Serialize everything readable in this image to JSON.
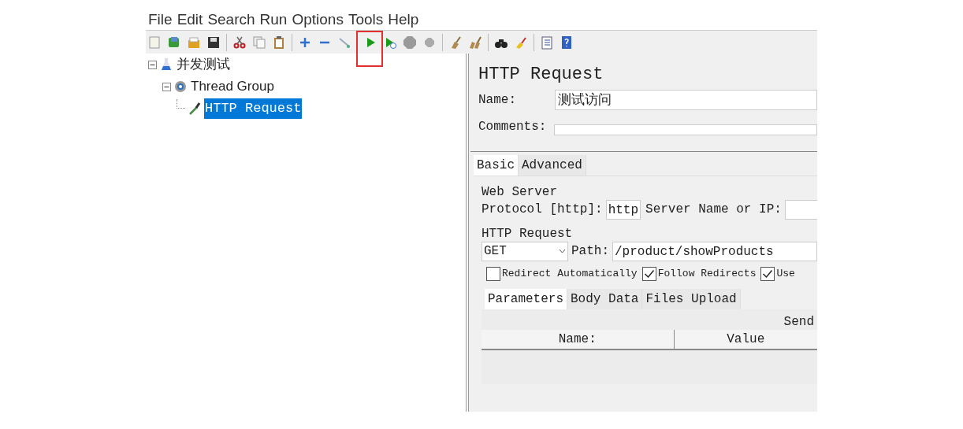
{
  "menu": [
    {
      "label": "File"
    },
    {
      "label": "Edit"
    },
    {
      "label": "Search"
    },
    {
      "label": "Run"
    },
    {
      "label": "Options"
    },
    {
      "label": "Tools"
    },
    {
      "label": "Help"
    }
  ],
  "toolbar": [
    {
      "kind": "button",
      "highlighted": false
    },
    {
      "kind": "button",
      "highlighted": false
    },
    {
      "kind": "button",
      "highlighted": false
    },
    {
      "kind": "button",
      "highlighted": false
    },
    {
      "kind": "separator"
    },
    {
      "kind": "button",
      "highlighted": false
    },
    {
      "kind": "button",
      "highlighted": false
    },
    {
      "kind": "button",
      "highlighted": false
    },
    {
      "kind": "separator"
    },
    {
      "kind": "button",
      "highlighted": false
    },
    {
      "kind": "button",
      "highlighted": false
    },
    {
      "kind": "button",
      "highlighted": false
    },
    {
      "kind": "separator"
    },
    {
      "kind": "button",
      "highlighted": true
    },
    {
      "kind": "button",
      "highlighted": false
    },
    {
      "kind": "button",
      "highlighted": false
    },
    {
      "kind": "button",
      "highlighted": false
    },
    {
      "kind": "separator"
    },
    {
      "kind": "button",
      "highlighted": false
    },
    {
      "kind": "button",
      "highlighted": false
    },
    {
      "kind": "separator"
    },
    {
      "kind": "button",
      "highlighted": false
    },
    {
      "kind": "button",
      "highlighted": false
    },
    {
      "kind": "separator"
    },
    {
      "kind": "button",
      "highlighted": false
    },
    {
      "kind": "button",
      "highlighted": false
    }
  ],
  "tree": [
    {
      "label": "并发测试",
      "expanded": true,
      "selected": false,
      "children": [
        {
          "label": "Thread Group",
          "expanded": true,
          "selected": false,
          "children": [
            {
              "label": "HTTP Request",
              "selected": true
            }
          ]
        }
      ]
    }
  ],
  "panel": {
    "title": "HTTP Request",
    "name_label": "Name:",
    "name_value": "测试访问",
    "comments_label": "Comments:",
    "tabs": [
      {
        "label": "Basic",
        "selected": true
      },
      {
        "label": "Advanced",
        "selected": false
      }
    ],
    "web_server": {
      "legend": "Web Server",
      "protocol_label": "Protocol [http]:",
      "protocol_value": "http",
      "server_label": "Server Name or IP:"
    },
    "http_request": {
      "legend": "HTTP Request",
      "method": "GET",
      "path_label": "Path:",
      "path_value": "/product/showProducts",
      "options": [
        {
          "label": "Redirect Automatically",
          "checked": false
        },
        {
          "label": "Follow Redirects",
          "checked": true
        },
        {
          "label": "Use",
          "checked": true
        }
      ]
    },
    "param_tabs": [
      {
        "label": "Parameters",
        "selected": true
      },
      {
        "label": "Body Data",
        "selected": false
      },
      {
        "label": "Files Upload",
        "selected": false
      }
    ],
    "table": {
      "caption": "Send",
      "columns": [
        "Name:",
        "Value"
      ]
    }
  }
}
